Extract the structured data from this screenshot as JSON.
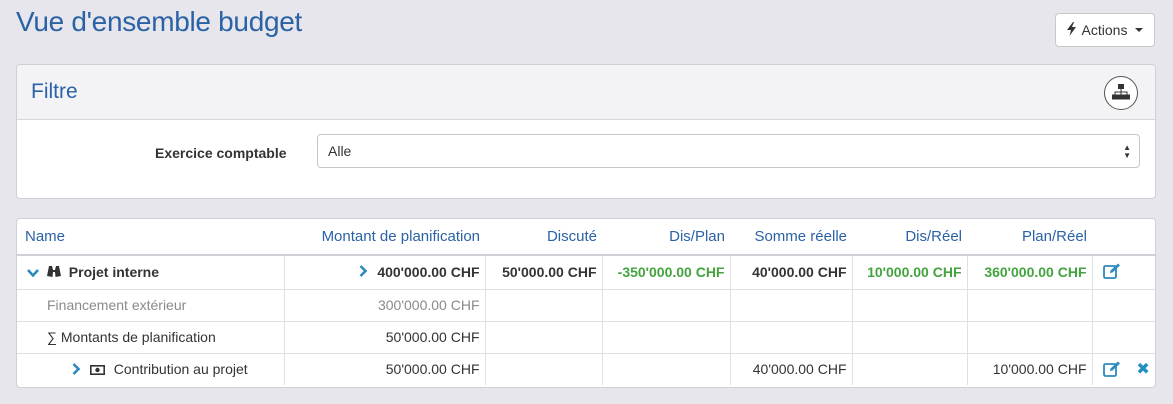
{
  "page": {
    "title": "Vue d'ensemble budget"
  },
  "actions": {
    "label": "Actions"
  },
  "filter": {
    "title": "Filtre",
    "fiscal_label": "Exercice comptable",
    "fiscal_value": "Alle"
  },
  "table": {
    "headers": {
      "name": "Name",
      "planned": "Montant de planification",
      "discussed": "Discuté",
      "dis_plan": "Dis/Plan",
      "actual": "Somme réelle",
      "dis_real": "Dis/Réel",
      "plan_real": "Plan/Réel"
    },
    "rows": [
      {
        "name": "Projet interne",
        "planned": "400'000.00 CHF",
        "discussed": "50'000.00 CHF",
        "dis_plan": "-350'000.00 CHF",
        "actual": "40'000.00 CHF",
        "dis_real": "10'000.00 CHF",
        "plan_real": "360'000.00 CHF"
      },
      {
        "name": "Financement extérieur",
        "planned": "300'000.00 CHF"
      },
      {
        "name": "∑ Montants de planification",
        "planned": "50'000.00 CHF"
      },
      {
        "name": "Contribution au projet",
        "planned": "50'000.00 CHF",
        "actual": "40'000.00 CHF",
        "plan_real": "10'000.00 CHF"
      }
    ]
  },
  "colors": {
    "accent": "#2b62a6",
    "positive": "#44a33f",
    "link": "#2b8ac0"
  }
}
